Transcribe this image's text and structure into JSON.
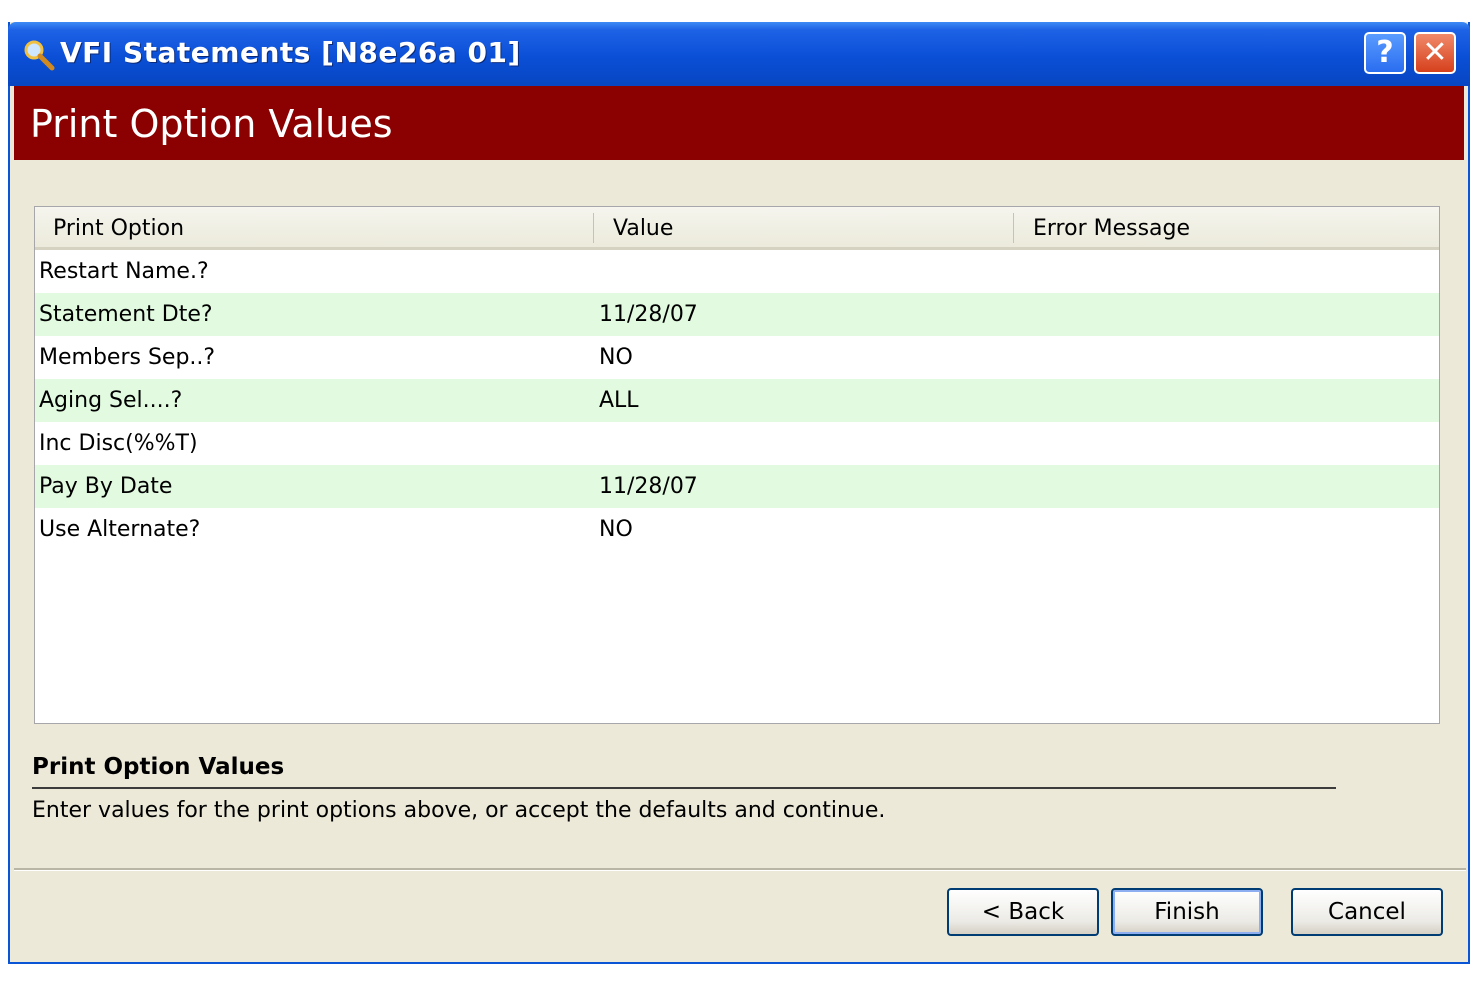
{
  "window": {
    "title": "VFI Statements [N8e26a 01]",
    "help_label": "?",
    "close_label": "✕"
  },
  "banner": {
    "title": "Print Option Values"
  },
  "table": {
    "columns": [
      "Print Option",
      "Value",
      "Error Message"
    ],
    "rows": [
      {
        "option": "Restart Name.?",
        "value": "",
        "error": ""
      },
      {
        "option": "Statement Dte?",
        "value": "11/28/07",
        "error": ""
      },
      {
        "option": "Members Sep..?",
        "value": "NO",
        "error": ""
      },
      {
        "option": "Aging Sel....?",
        "value": "ALL",
        "error": ""
      },
      {
        "option": "Inc Disc(%%T)",
        "value": "",
        "error": ""
      },
      {
        "option": "Pay By Date",
        "value": "11/28/07",
        "error": ""
      },
      {
        "option": "Use Alternate?",
        "value": "NO",
        "error": ""
      }
    ]
  },
  "description": {
    "title": "Print Option Values",
    "text": "Enter values for the print options above, or accept the defaults and continue."
  },
  "buttons": {
    "back": "< Back",
    "finish": "Finish",
    "cancel": "Cancel"
  },
  "colors": {
    "titlebar": "#0a4fd6",
    "banner": "#8b0000",
    "alt_row": "#e2fbe0",
    "dialog": "#ece9d8"
  }
}
